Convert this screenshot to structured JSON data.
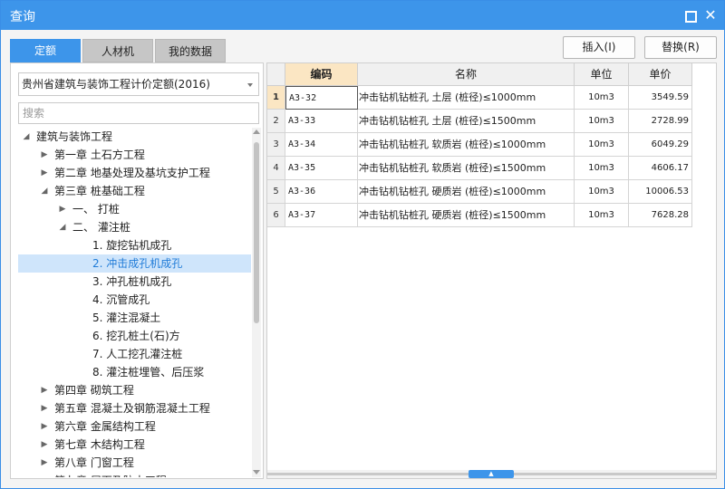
{
  "window": {
    "title": "查询"
  },
  "tabs": [
    {
      "label": "定额",
      "active": true
    },
    {
      "label": "人材机",
      "active": false
    },
    {
      "label": "我的数据",
      "active": false
    }
  ],
  "actions": {
    "insert_label": "插入(I)",
    "replace_label": "替换(R)"
  },
  "left": {
    "library_select": "贵州省建筑与装饰工程计价定额(2016)",
    "search_placeholder": "搜索",
    "tree": [
      {
        "label": "建筑与装饰工程",
        "level": 0,
        "toggle": "expanded"
      },
      {
        "label": "第一章 土石方工程",
        "level": 1,
        "toggle": "collapsed"
      },
      {
        "label": "第二章 地基处理及基坑支护工程",
        "level": 1,
        "toggle": "collapsed"
      },
      {
        "label": "第三章 桩基础工程",
        "level": 1,
        "toggle": "expanded"
      },
      {
        "label": "一、  打桩",
        "level": 2,
        "toggle": "collapsed"
      },
      {
        "label": "二、  灌注桩",
        "level": 2,
        "toggle": "expanded"
      },
      {
        "label": "1. 旋挖钻机成孔",
        "level": 3,
        "toggle": "none"
      },
      {
        "label": "2. 冲击成孔机成孔",
        "level": 3,
        "toggle": "none",
        "selected": true
      },
      {
        "label": "3. 冲孔桩机成孔",
        "level": 3,
        "toggle": "none"
      },
      {
        "label": "4. 沉管成孔",
        "level": 3,
        "toggle": "none"
      },
      {
        "label": "5. 灌注混凝土",
        "level": 3,
        "toggle": "none"
      },
      {
        "label": "6. 挖孔桩土(石)方",
        "level": 3,
        "toggle": "none"
      },
      {
        "label": "7. 人工挖孔灌注桩",
        "level": 3,
        "toggle": "none"
      },
      {
        "label": "8. 灌注桩埋管、后压浆",
        "level": 3,
        "toggle": "none"
      },
      {
        "label": "第四章 砌筑工程",
        "level": 1,
        "toggle": "collapsed"
      },
      {
        "label": "第五章 混凝土及钢筋混凝土工程",
        "level": 1,
        "toggle": "collapsed"
      },
      {
        "label": "第六章 金属结构工程",
        "level": 1,
        "toggle": "collapsed"
      },
      {
        "label": "第七章 木结构工程",
        "level": 1,
        "toggle": "collapsed"
      },
      {
        "label": "第八章 门窗工程",
        "level": 1,
        "toggle": "collapsed"
      },
      {
        "label": "第九章 屋面及防水工程",
        "level": 1,
        "toggle": "collapsed"
      }
    ]
  },
  "grid": {
    "columns": [
      "编码",
      "名称",
      "单位",
      "单价"
    ],
    "rows": [
      {
        "num": "1",
        "code": "A3-32",
        "name": "冲击钻机钻桩孔 土层 (桩径)≤1000mm",
        "unit": "10m3",
        "price": "3549.59"
      },
      {
        "num": "2",
        "code": "A3-33",
        "name": "冲击钻机钻桩孔 土层 (桩径)≤1500mm",
        "unit": "10m3",
        "price": "2728.99"
      },
      {
        "num": "3",
        "code": "A3-34",
        "name": "冲击钻机钻桩孔 软质岩 (桩径)≤1000mm",
        "unit": "10m3",
        "price": "6049.29"
      },
      {
        "num": "4",
        "code": "A3-35",
        "name": "冲击钻机钻桩孔 软质岩 (桩径)≤1500mm",
        "unit": "10m3",
        "price": "4606.17"
      },
      {
        "num": "5",
        "code": "A3-36",
        "name": "冲击钻机钻桩孔 硬质岩 (桩径)≤1000mm",
        "unit": "10m3",
        "price": "10006.53"
      },
      {
        "num": "6",
        "code": "A3-37",
        "name": "冲击钻机钻桩孔 硬质岩 (桩径)≤1500mm",
        "unit": "10m3",
        "price": "7628.28"
      }
    ],
    "selected_row": 0
  },
  "icons": {
    "maximize": "maximize-icon",
    "close": "close-icon",
    "expanded": "triangle-down-icon",
    "collapsed": "triangle-right-icon"
  }
}
